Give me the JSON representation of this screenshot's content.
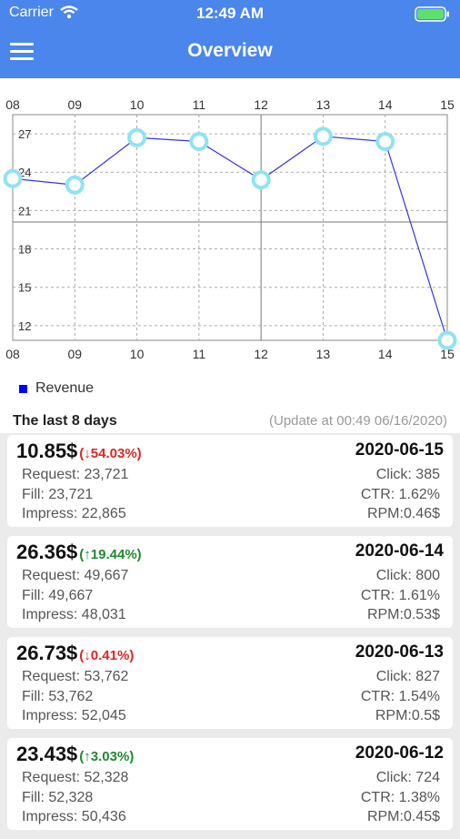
{
  "status": {
    "carrier": "Carrier",
    "time": "12:49 AM"
  },
  "header": {
    "title": "Overview",
    "menu_icon": "hamburger-menu-icon"
  },
  "chart_data": {
    "type": "line",
    "x": [
      "08",
      "09",
      "10",
      "11",
      "12",
      "13",
      "14",
      "15"
    ],
    "series": [
      {
        "name": "Revenue",
        "values": [
          23.43,
          26.73,
          26.36,
          10.85
        ],
        "values_full": [
          23.5,
          23.0,
          26.7,
          26.4,
          23.4,
          26.8,
          26.4,
          10.85
        ]
      }
    ],
    "yticks": [
      12,
      15,
      18,
      21,
      24,
      27
    ],
    "ylim": [
      10.85,
      28.5
    ],
    "legend": "bottom-left",
    "grid": true,
    "colors": {
      "line": "#3333dd",
      "marker": "#8fe3f2"
    }
  },
  "legend": {
    "label": "Revenue"
  },
  "section": {
    "title": "The last 8 days",
    "update": "(Update at 00:49 06/16/2020)"
  },
  "cards": [
    {
      "revenue": "10.85$",
      "change": "(↓54.03%)",
      "direction": "down",
      "date": "2020-06-15",
      "request": "Request: 23,721",
      "fill": "Fill: 23,721",
      "impress": "Impress: 22,865",
      "click": "Click: 385",
      "ctr": "CTR: 1.62%",
      "rpm": "RPM:0.46$"
    },
    {
      "revenue": "26.36$",
      "change": "(↑19.44%)",
      "direction": "up",
      "date": "2020-06-14",
      "request": "Request: 49,667",
      "fill": "Fill: 49,667",
      "impress": "Impress: 48,031",
      "click": "Click: 800",
      "ctr": "CTR: 1.61%",
      "rpm": "RPM:0.53$"
    },
    {
      "revenue": "26.73$",
      "change": "(↓0.41%)",
      "direction": "down",
      "date": "2020-06-13",
      "request": "Request: 53,762",
      "fill": "Fill: 53,762",
      "impress": "Impress: 52,045",
      "click": "Click: 827",
      "ctr": "CTR: 1.54%",
      "rpm": "RPM:0.5$"
    },
    {
      "revenue": "23.43$",
      "change": "(↑3.03%)",
      "direction": "up",
      "date": "2020-06-12",
      "request": "Request: 52,328",
      "fill": "Fill: 52,328",
      "impress": "Impress: 50,436",
      "click": "Click: 724",
      "ctr": "CTR: 1.38%",
      "rpm": "RPM:0.45$"
    }
  ]
}
